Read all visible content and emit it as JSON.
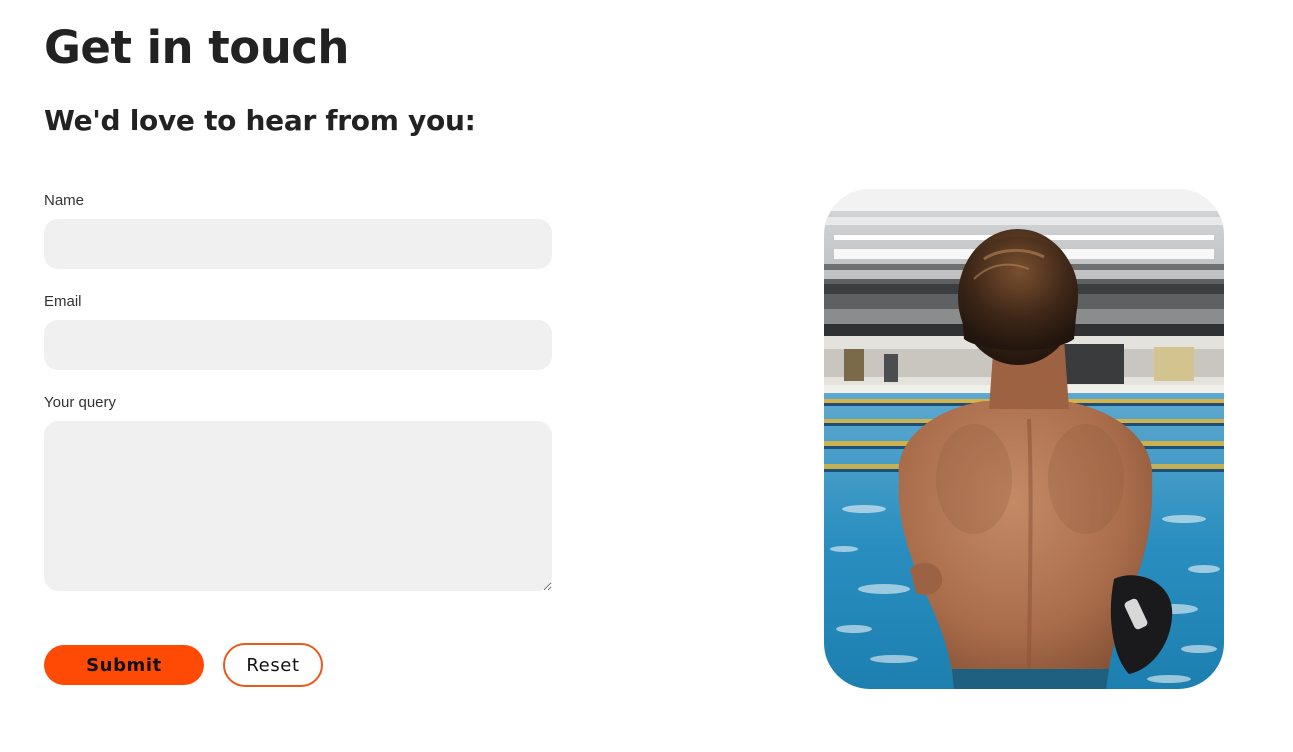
{
  "header": {
    "title": "Get in touch",
    "subtitle": "We'd love to hear from you:"
  },
  "form": {
    "name_label": "Name",
    "name_value": "",
    "email_label": "Email",
    "email_value": "",
    "query_label": "Your query",
    "query_value": ""
  },
  "actions": {
    "submit_label": "Submit",
    "reset_label": "Reset"
  },
  "colors": {
    "accent": "#ff4a06",
    "input_bg": "#f0f0f0",
    "text": "#222222"
  },
  "image": {
    "subject": "swimmer-at-pool-photo"
  }
}
